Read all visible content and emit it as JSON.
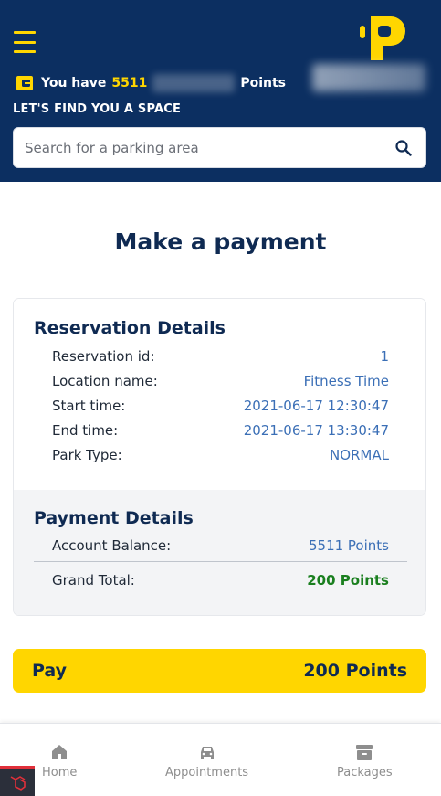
{
  "header": {
    "points_prefix": "You have",
    "points_value": "5511",
    "points_suffix": "Points",
    "find_title": "LET'S FIND YOU A SPACE",
    "search_placeholder": "Search for a parking area"
  },
  "main": {
    "title": "Make a payment",
    "reservation": {
      "title": "Reservation Details",
      "rows": [
        {
          "label": "Reservation id:",
          "value": "1"
        },
        {
          "label": "Location name:",
          "value": "Fitness Time"
        },
        {
          "label": "Start time:",
          "value": "2021-06-17 12:30:47"
        },
        {
          "label": "End time:",
          "value": "2021-06-17 13:30:47"
        },
        {
          "label": "Park Type:",
          "value": "NORMAL"
        }
      ]
    },
    "payment": {
      "title": "Payment Details",
      "balance_label": "Account Balance:",
      "balance_value": "5511 Points",
      "total_label": "Grand Total:",
      "total_value": "200 Points"
    },
    "pay_button": {
      "label": "Pay",
      "amount": "200 Points"
    }
  },
  "bottom_nav": {
    "items": [
      {
        "label": "Home",
        "icon": "home-icon"
      },
      {
        "label": "Appointments",
        "icon": "car-icon"
      },
      {
        "label": "Packages",
        "icon": "archive-icon"
      }
    ]
  },
  "colors": {
    "header_bg": "#0c2f61",
    "accent": "#ffd600",
    "value_blue": "#3b6fb6",
    "total_green": "#1a7f1f"
  }
}
